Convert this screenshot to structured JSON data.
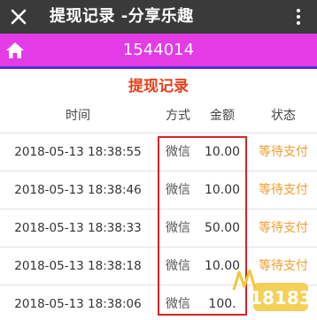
{
  "titlebar": {
    "close_icon": "close-icon",
    "title": "提现记录 -分享乐趣",
    "more_icon": "more-vertical-icon"
  },
  "navbar": {
    "home_icon": "home-icon",
    "user_id": "1544014",
    "background": "#e33ce6",
    "underline": "#5a2bd6"
  },
  "section": {
    "title": "提现记录",
    "title_color": "#e8401c"
  },
  "table": {
    "headers": {
      "time": "时间",
      "method": "方式",
      "amount": "金额",
      "status": "状态"
    },
    "rows": [
      {
        "time": "2018-05-13 18:38:55",
        "method": "微信",
        "amount": "10.00",
        "status": "等待支付"
      },
      {
        "time": "2018-05-13 18:38:46",
        "method": "微信",
        "amount": "10.00",
        "status": "等待支付"
      },
      {
        "time": "2018-05-13 18:38:33",
        "method": "微信",
        "amount": "50.00",
        "status": "等待支付"
      },
      {
        "time": "2018-05-13 18:38:18",
        "method": "微信",
        "amount": "10.00",
        "status": "等待支付"
      },
      {
        "time": "2018-05-13 18:38:06",
        "method": "微信",
        "amount": "100.",
        "status": ""
      }
    ],
    "status_color": "#f29c2c"
  },
  "watermark": {
    "text": "18183",
    "icon": "watermark-logo"
  }
}
